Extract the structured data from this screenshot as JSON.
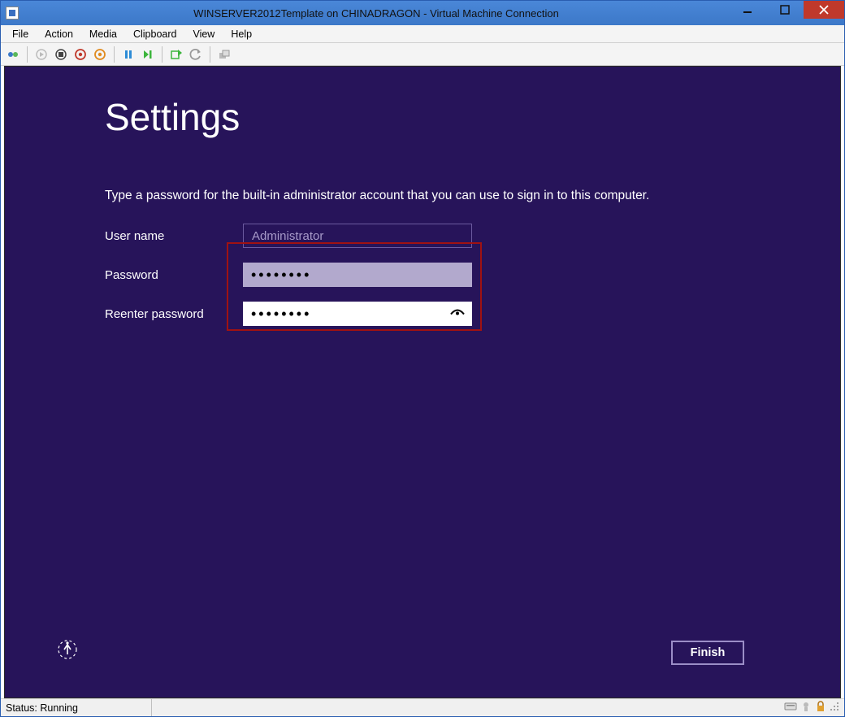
{
  "titlebar": {
    "title": "WINSERVER2012Template on CHINADRAGON - Virtual Machine Connection"
  },
  "menu": {
    "file": "File",
    "action": "Action",
    "media": "Media",
    "clipboard": "Clipboard",
    "view": "View",
    "help": "Help"
  },
  "settings": {
    "heading": "Settings",
    "subtitle": "Type a password for the built-in administrator account that you can use to sign in to this computer.",
    "username_label": "User name",
    "username_value": "Administrator",
    "password_label": "Password",
    "password_dots": "••••••••",
    "reenter_label": "Reenter password",
    "reenter_dots": "••••••••",
    "finish": "Finish"
  },
  "status": {
    "text": "Status: Running"
  }
}
